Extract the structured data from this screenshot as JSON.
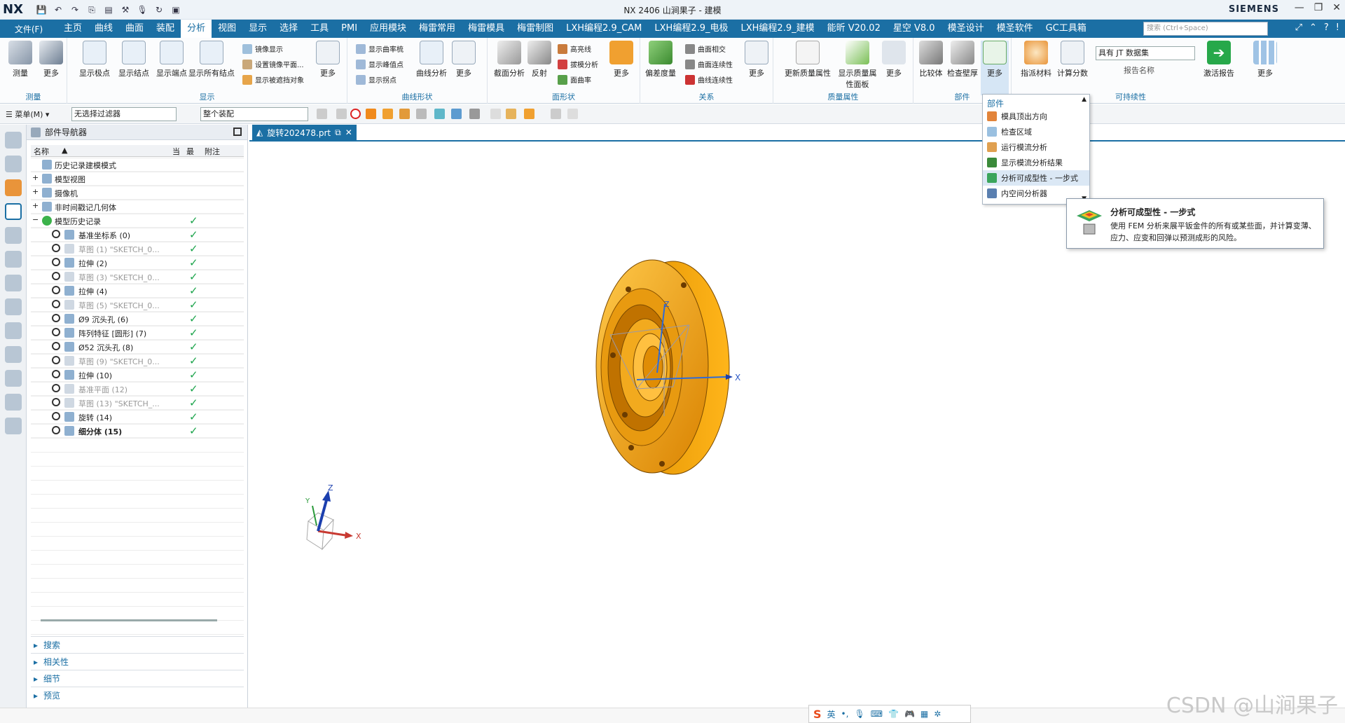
{
  "app": {
    "logo": "NX",
    "window_title": "NX 2406 山涧果子 - 建模",
    "brand": "SIEMENS",
    "window_controls": [
      "—",
      "❐",
      "✕"
    ]
  },
  "menubar": {
    "file_label": "文件(F)",
    "tabs": [
      "主页",
      "曲线",
      "曲面",
      "装配",
      "分析",
      "视图",
      "显示",
      "选择",
      "工具",
      "PMI",
      "应用模块",
      "梅雷常用",
      "梅雷模具",
      "梅雷制图",
      "LXH编程2.9_CAM",
      "LXH编程2.9_电极",
      "LXH编程2.9_建模",
      "能昕 V20.02",
      "星空 V8.0",
      "模圣设计",
      "模圣软件",
      "GC工具箱"
    ],
    "active_tab": "分析",
    "search_placeholder": "搜索 (Ctrl+Space)"
  },
  "ribbon": {
    "groups": [
      {
        "name": "测量",
        "buttons": [
          "测量",
          "更多"
        ]
      },
      {
        "name": "显示",
        "buttons": [
          "显示极点",
          "显示结点",
          "显示端点",
          "显示所有结点"
        ],
        "small": [
          "镜像显示",
          "设置镜像平面...",
          "显示被遮挡对象"
        ],
        "more": "更多"
      },
      {
        "name": "曲线形状",
        "small": [
          "显示曲率梳",
          "显示峰值点",
          "显示拐点"
        ],
        "buttons": [
          "曲线分析"
        ],
        "more": "更多"
      },
      {
        "name": "面形状",
        "buttons": [
          "截面分析",
          "反射"
        ],
        "small": [
          "高亮线",
          "拔模分析",
          "面曲率"
        ],
        "more": "更多"
      },
      {
        "name": "关系",
        "buttons": [
          "偏差度量"
        ],
        "small": [
          "曲面相交",
          "曲面连续性",
          "曲线连续性"
        ],
        "more": "更多"
      },
      {
        "name": "质量属性",
        "buttons": [
          "更新质量属性",
          "显示质量属性面板"
        ],
        "more": "更多"
      },
      {
        "name": "部件",
        "buttons": [
          "比较体",
          "检查壁厚"
        ],
        "more": "更多"
      },
      {
        "name": "可持续性",
        "buttons": [
          "指派材料",
          "计算分数"
        ],
        "select_value": "具有 JT 数据集",
        "report_label": "报告名称",
        "activate": "激活报告",
        "more": "更多"
      }
    ]
  },
  "toolbar2": {
    "menu_label": "菜单(M)",
    "filter": "无选择过滤器",
    "scope": "整个装配"
  },
  "navigator": {
    "title": "部件导航器",
    "columns": [
      "名称",
      "当",
      "最",
      "附注"
    ],
    "rows": [
      {
        "label": "历史记录建模模式",
        "indent": 0,
        "check": false,
        "dim": false
      },
      {
        "label": "模型视图",
        "indent": 0,
        "check": false,
        "dim": false
      },
      {
        "label": "摄像机",
        "indent": 0,
        "check": false,
        "dim": false
      },
      {
        "label": "非时间戳记几何体",
        "indent": 0,
        "check": false,
        "dim": false
      },
      {
        "label": "模型历史记录",
        "indent": 0,
        "check": true,
        "dim": false
      },
      {
        "label": "基准坐标系 (0)",
        "indent": 1,
        "check": true,
        "dim": false
      },
      {
        "label": "草图 (1) \"SKETCH_0...",
        "indent": 1,
        "check": true,
        "dim": true
      },
      {
        "label": "拉伸 (2)",
        "indent": 1,
        "check": true,
        "dim": false
      },
      {
        "label": "草图 (3) \"SKETCH_0...",
        "indent": 1,
        "check": true,
        "dim": true
      },
      {
        "label": "拉伸 (4)",
        "indent": 1,
        "check": true,
        "dim": false
      },
      {
        "label": "草图 (5) \"SKETCH_0...",
        "indent": 1,
        "check": true,
        "dim": true
      },
      {
        "label": "Ø9 沉头孔 (6)",
        "indent": 1,
        "check": true,
        "dim": false
      },
      {
        "label": "阵列特征 [圆形] (7)",
        "indent": 1,
        "check": true,
        "dim": false
      },
      {
        "label": "Ø52 沉头孔 (8)",
        "indent": 1,
        "check": true,
        "dim": false
      },
      {
        "label": "草图 (9) \"SKETCH_0...",
        "indent": 1,
        "check": true,
        "dim": true
      },
      {
        "label": "拉伸 (10)",
        "indent": 1,
        "check": true,
        "dim": false
      },
      {
        "label": "基准平面 (12)",
        "indent": 1,
        "check": true,
        "dim": true
      },
      {
        "label": "草图 (13) \"SKETCH_...",
        "indent": 1,
        "check": true,
        "dim": true
      },
      {
        "label": "旋转 (14)",
        "indent": 1,
        "check": true,
        "dim": false
      },
      {
        "label": "细分体 (15)",
        "indent": 1,
        "check": true,
        "dim": false
      }
    ],
    "sections": [
      "搜索",
      "相关性",
      "细节",
      "预览"
    ]
  },
  "viewport": {
    "tab_label": "旋转202478.prt",
    "axis_x": "X",
    "axis_y": "Y",
    "axis_z": "Z",
    "part_color": "#f0a30a"
  },
  "dropdown": {
    "title": "部件",
    "items": [
      "模具顶出方向",
      "检查区域",
      "运行模流分析",
      "显示模流分析结果",
      "分析可成型性 - 一步式",
      "内空间分析器"
    ],
    "highlighted_index": 4
  },
  "tooltip": {
    "title": "分析可成型性 - 一步式",
    "description": "使用 FEM 分析来展平钣金件的所有或某些面，并计算变薄、应力、应变和回弹以预测成形的风险。"
  },
  "ime": {
    "label": "英"
  },
  "watermark": "CSDN @山涧果子",
  "colors": {
    "accent": "#1b6fa4",
    "check": "#1aa34a",
    "part": "#f0a30a"
  }
}
